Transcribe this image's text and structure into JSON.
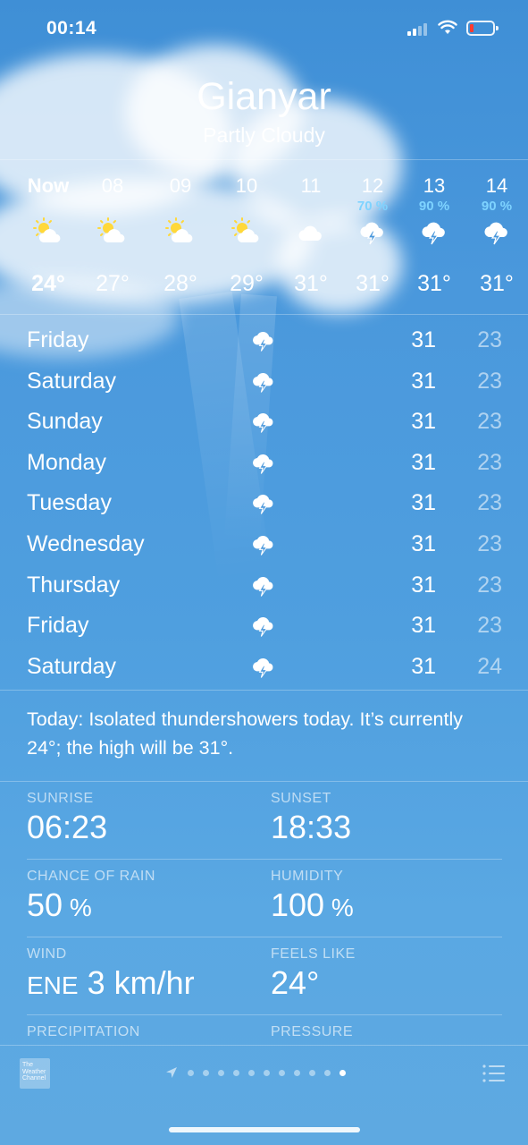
{
  "status_bar": {
    "time": "00:14"
  },
  "header": {
    "city": "Gianyar",
    "condition": "Partly Cloudy"
  },
  "hourly": [
    {
      "label": "Now",
      "icon": "sun-cloud-icon",
      "precip": "",
      "temp": "24°"
    },
    {
      "label": "08",
      "icon": "sun-cloud-icon",
      "precip": "",
      "temp": "27°"
    },
    {
      "label": "09",
      "icon": "sun-cloud-icon",
      "precip": "",
      "temp": "28°"
    },
    {
      "label": "10",
      "icon": "sun-cloud-icon",
      "precip": "",
      "temp": "29°"
    },
    {
      "label": "11",
      "icon": "cloud-icon",
      "precip": "",
      "temp": "31°"
    },
    {
      "label": "12",
      "icon": "thunderstorm-icon",
      "precip": "70 %",
      "temp": "31°"
    },
    {
      "label": "13",
      "icon": "thunderstorm-icon",
      "precip": "90 %",
      "temp": "31°"
    },
    {
      "label": "14",
      "icon": "thunderstorm-icon",
      "precip": "90 %",
      "temp": "31°"
    }
  ],
  "daily": [
    {
      "day": "Friday",
      "icon": "thunderstorm-icon",
      "high": "31",
      "low": "23"
    },
    {
      "day": "Saturday",
      "icon": "thunderstorm-icon",
      "high": "31",
      "low": "23"
    },
    {
      "day": "Sunday",
      "icon": "thunderstorm-icon",
      "high": "31",
      "low": "23"
    },
    {
      "day": "Monday",
      "icon": "thunderstorm-icon",
      "high": "31",
      "low": "23"
    },
    {
      "day": "Tuesday",
      "icon": "thunderstorm-icon",
      "high": "31",
      "low": "23"
    },
    {
      "day": "Wednesday",
      "icon": "thunderstorm-icon",
      "high": "31",
      "low": "23"
    },
    {
      "day": "Thursday",
      "icon": "thunderstorm-icon",
      "high": "31",
      "low": "23"
    },
    {
      "day": "Friday",
      "icon": "thunderstorm-icon",
      "high": "31",
      "low": "23"
    },
    {
      "day": "Saturday",
      "icon": "thunderstorm-icon",
      "high": "31",
      "low": "24"
    }
  ],
  "summary": "Today: Isolated thundershowers today. It’s currently 24°; the high will be 31°.",
  "details": {
    "sunrise": {
      "label": "SUNRISE",
      "value": "06:23"
    },
    "sunset": {
      "label": "SUNSET",
      "value": "18:33"
    },
    "chance_of_rain": {
      "label": "CHANCE OF RAIN",
      "value": "50",
      "unit": " %"
    },
    "humidity": {
      "label": "HUMIDITY",
      "value": "100",
      "unit": " %"
    },
    "wind": {
      "label": "WIND",
      "direction": "ENE",
      "value": " 3 km/hr"
    },
    "feels_like": {
      "label": "FEELS LIKE",
      "value": "24°"
    },
    "precipitation": {
      "label": "PRECIPITATION"
    },
    "pressure": {
      "label": "PRESSURE"
    }
  },
  "toolbar": {
    "logo_text": "The Weather Channel",
    "page_count": 11,
    "active_page": 10
  },
  "colors": {
    "precip_text": "#7ed3ff",
    "battery_low": "#ff3b30",
    "sky_top": "#3f8fd6",
    "sky_bottom": "#5ea9e1"
  }
}
